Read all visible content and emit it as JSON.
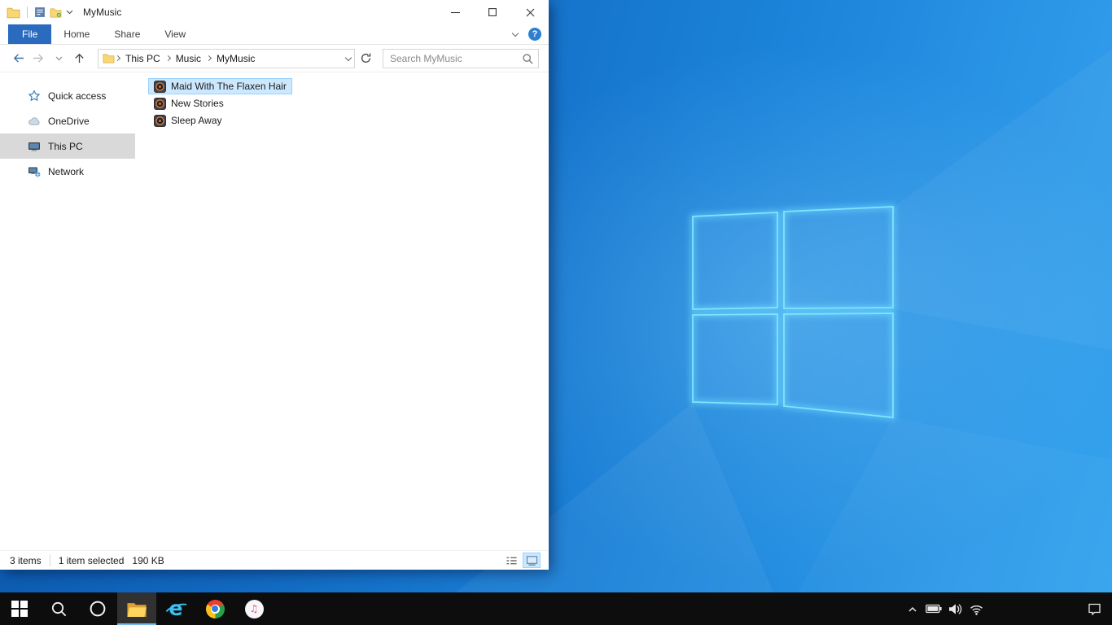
{
  "colors": {
    "accent": "#0078d7",
    "file_tab_bg": "#2a6bbf",
    "selection_bg": "#cce8ff",
    "selection_border": "#99d1ff",
    "inactive_selection_bg": "#d9d9d9",
    "taskbar_bg": "#0d0d0d",
    "wallpaper_dark": "#0a55a8",
    "wallpaper_light": "#35a3ee",
    "logo_stroke": "#6fdcff"
  },
  "window": {
    "title": "MyMusic",
    "quick_access_toolbar": {
      "icons": [
        "folder-icon",
        "properties-icon",
        "new-folder-icon",
        "chevron-down-icon"
      ]
    },
    "caption_buttons": [
      "minimize",
      "maximize",
      "close"
    ],
    "ribbon": {
      "tabs": [
        {
          "label": "File",
          "active": true
        },
        {
          "label": "Home",
          "active": false
        },
        {
          "label": "Share",
          "active": false
        },
        {
          "label": "View",
          "active": false
        }
      ],
      "help_glyph": "?"
    },
    "address_bar": {
      "breadcrumb": [
        {
          "label": "This PC"
        },
        {
          "label": "Music"
        },
        {
          "label": "MyMusic"
        }
      ]
    },
    "search_placeholder": "Search MyMusic",
    "sidebar": {
      "items": [
        {
          "label": "Quick access",
          "icon": "star-icon",
          "selected": false
        },
        {
          "label": "OneDrive",
          "icon": "cloud-icon",
          "selected": false
        },
        {
          "label": "This PC",
          "icon": "computer-icon",
          "selected": true
        },
        {
          "label": "Network",
          "icon": "network-icon",
          "selected": false
        }
      ]
    },
    "files": [
      {
        "name": "Maid With The Flaxen Hair",
        "icon": "audio-file-icon",
        "selected": true
      },
      {
        "name": "New Stories",
        "icon": "audio-file-icon",
        "selected": false
      },
      {
        "name": "Sleep Away",
        "icon": "audio-file-icon",
        "selected": false
      }
    ],
    "status_bar": {
      "items_count": "3 items",
      "selection_count": "1 item selected",
      "selection_size": "190 KB"
    }
  },
  "taskbar": {
    "buttons": [
      {
        "name": "start",
        "icon": "windows-logo-icon",
        "active": false
      },
      {
        "name": "search",
        "icon": "search-icon",
        "active": false
      },
      {
        "name": "cortana",
        "icon": "cortana-icon",
        "active": false
      },
      {
        "name": "file-explorer",
        "icon": "file-explorer-icon",
        "active": true
      },
      {
        "name": "internet-explorer",
        "icon": "internet-explorer-icon",
        "active": false
      },
      {
        "name": "chrome",
        "icon": "chrome-icon",
        "active": false
      },
      {
        "name": "itunes",
        "icon": "itunes-icon",
        "active": false
      }
    ],
    "tray_icons": [
      "chevron-up-icon",
      "battery-icon",
      "volume-icon",
      "wifi-icon"
    ],
    "action_center_icon": "action-center-icon"
  }
}
